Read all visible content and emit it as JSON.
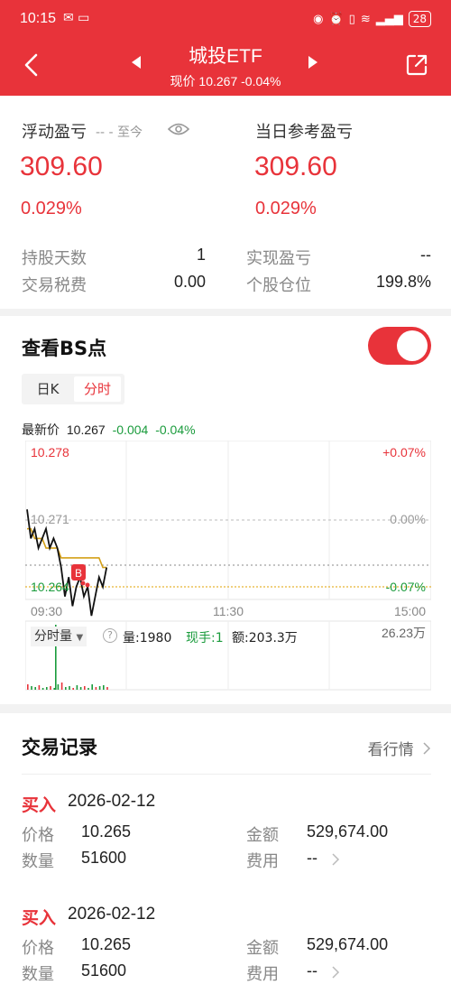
{
  "status": {
    "time": "10:15",
    "battery": "28"
  },
  "header": {
    "title": "城投ETF",
    "subtitle": "现价 10.267 -0.04%"
  },
  "pl": {
    "float_label": "浮动盈亏",
    "float_range": "-- - 至今",
    "float_value": "309.60",
    "float_pct": "0.029%",
    "day_label": "当日参考盈亏",
    "day_value": "309.60",
    "day_pct": "0.029%",
    "rows": [
      {
        "label": "持股天数",
        "value": "1"
      },
      {
        "label": "实现盈亏",
        "value": "--"
      },
      {
        "label": "交易税费",
        "value": "0.00"
      },
      {
        "label": "个股仓位",
        "value": "199.8%"
      }
    ]
  },
  "bs": {
    "title": "查看BS点",
    "tab_day": "日K",
    "tab_min": "分时",
    "latest_label": "最新价",
    "latest_price": "10.267",
    "latest_change": "-0.004",
    "latest_pct": "-0.04%"
  },
  "chart_data": {
    "type": "line",
    "y_labels": {
      "high": "10.278",
      "mid": "10.271",
      "low": "10.264"
    },
    "pct_labels": {
      "high": "+0.07%",
      "mid": "0.00%",
      "low": "-0.07%"
    },
    "x_labels": [
      "09:30",
      "11:30",
      "15:00"
    ],
    "marker": "B",
    "volume_tab": "分时量",
    "volume_info": {
      "qty": "量:1980",
      "hand": "现手:1",
      "amount": "额:203.3万"
    },
    "volume_max": "26.23万",
    "price": [
      10.272,
      10.269,
      10.27,
      10.268,
      10.269,
      10.27,
      10.268,
      10.269,
      10.268,
      10.266,
      10.263,
      10.265,
      10.262,
      10.264,
      10.265,
      10.263,
      10.264,
      10.261,
      10.263,
      10.265,
      10.264,
      10.266
    ],
    "avg": [
      10.27,
      10.27,
      10.269,
      10.269,
      10.269,
      10.268,
      10.268,
      10.268,
      10.268,
      10.267,
      10.267,
      10.267,
      10.267,
      10.267,
      10.267,
      10.267,
      10.267,
      10.267,
      10.267,
      10.267,
      10.266,
      10.266
    ]
  },
  "trades": {
    "title": "交易记录",
    "more": "看行情",
    "records": [
      {
        "type": "买入",
        "date": "2026-02-12",
        "price_label": "价格",
        "price": "10.265",
        "amount_label": "金额",
        "amount": "529,674.00",
        "qty_label": "数量",
        "qty": "51600",
        "fee_label": "费用",
        "fee": "--"
      },
      {
        "type": "买入",
        "date": "2026-02-12",
        "price_label": "价格",
        "price": "10.265",
        "amount_label": "金额",
        "amount": "529,674.00",
        "qty_label": "数量",
        "qty": "51600",
        "fee_label": "费用",
        "fee": "--"
      }
    ]
  },
  "colors": {
    "red": "#e8333a",
    "green": "#1a9b3c",
    "avg_line": "#d4a017"
  }
}
